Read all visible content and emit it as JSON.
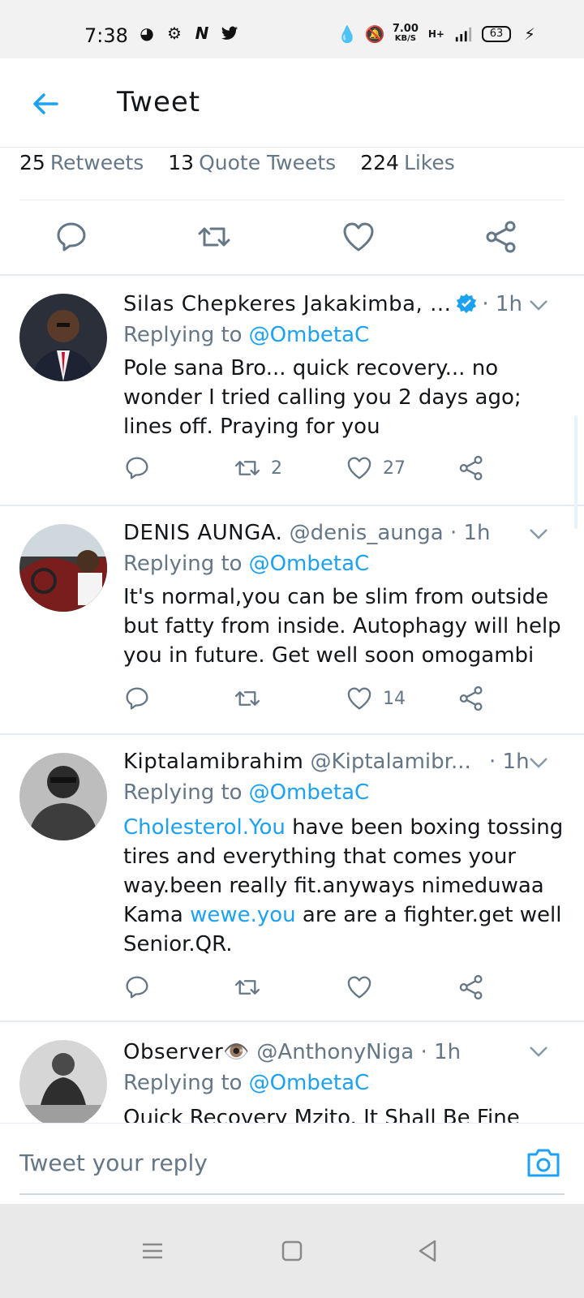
{
  "status_bar": {
    "time": "7:38",
    "net_speed": "7.00",
    "net_unit": "KB/S",
    "network": "H+",
    "battery": "63"
  },
  "header": {
    "title": "Tweet"
  },
  "stats": {
    "retweets_count": "25",
    "retweets_label": "Retweets",
    "quotes_count": "13",
    "quotes_label": "Quote Tweets",
    "likes_count": "224",
    "likes_label": "Likes"
  },
  "replies": [
    {
      "display_name": "Silas Chepkeres Jakakimba, ...",
      "handle": "",
      "time": "· 1h",
      "verified": true,
      "replying_prefix": "Replying to",
      "replying_to": "@OmbetaC",
      "text": "Pole sana Bro... quick recovery... no wonder I tried calling you 2 days ago; lines off. Praying for you",
      "retweets": "2",
      "likes": "27"
    },
    {
      "display_name": "DENIS AUNGA.",
      "handle": "@denis_aunga",
      "time": "· 1h",
      "verified": false,
      "replying_prefix": "Replying to",
      "replying_to": "@OmbetaC",
      "text": "It's normal,you can be slim from outside but fatty from inside. Autophagy will help you in future. Get well soon omogambi",
      "retweets": "",
      "likes": "14"
    },
    {
      "display_name": "Kiptalamibrahim",
      "handle": "@Kiptalamibr...",
      "time": "· 1h",
      "verified": false,
      "replying_prefix": "Replying to",
      "replying_to": "@OmbetaC",
      "text_link1": "Cholesterol.You",
      "text_part1": " have been boxing tossing tires and everything that comes your way.been really fit.anyways nimeduwaa Kama ",
      "text_link2": "wewe.you",
      "text_part2": " are are a fighter.get well Senior.QR.",
      "retweets": "",
      "likes": ""
    },
    {
      "display_name": "Observer👁️",
      "handle": "@AnthonyNiga",
      "time": "· 1h",
      "verified": false,
      "replying_prefix": "Replying to",
      "replying_to": "@OmbetaC",
      "text": "Quick Recovery Mzito. It Shall Be Fine"
    }
  ],
  "compose": {
    "placeholder": "Tweet your reply"
  },
  "colors": {
    "accent": "#1da1f2",
    "muted": "#657786",
    "divider": "#e6ecf0"
  }
}
